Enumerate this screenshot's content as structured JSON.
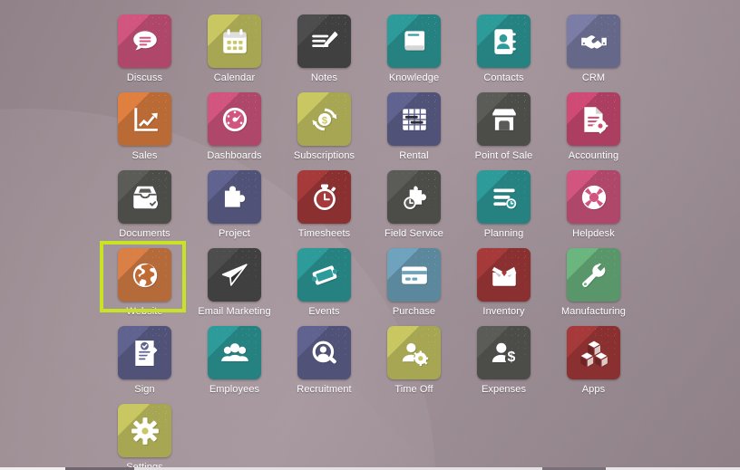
{
  "desktop": {
    "background_color": "#9b8c92",
    "highlight_color": "#c8e326"
  },
  "apps": [
    {
      "label": "Discuss",
      "icon": "chat-bubble-icon",
      "color": "#d1557f",
      "shadow_color": "#b0416a"
    },
    {
      "label": "Calendar",
      "icon": "calendar-icon",
      "color": "#c9c762",
      "shadow_color": "#a8a64c"
    },
    {
      "label": "Notes",
      "icon": "note-pencil-icon",
      "color": "#4d4d4d",
      "shadow_color": "#3a3a3a"
    },
    {
      "label": "Knowledge",
      "icon": "book-icon",
      "color": "#2e9b9b",
      "shadow_color": "#247c7c"
    },
    {
      "label": "Contacts",
      "icon": "address-book-icon",
      "color": "#2e9b9b",
      "shadow_color": "#247c7c"
    },
    {
      "label": "CRM",
      "icon": "handshake-icon",
      "color": "#7b7da6",
      "shadow_color": "#63658c"
    },
    {
      "label": "Sales",
      "icon": "chart-growth-icon",
      "color": "#e08040",
      "shadow_color": "#c06a30"
    },
    {
      "label": "Dashboards",
      "icon": "speedometer-icon",
      "color": "#d1557f",
      "shadow_color": "#b0416a"
    },
    {
      "label": "Subscriptions",
      "icon": "recurring-dollar-icon",
      "color": "#c9c762",
      "shadow_color": "#a8a64c"
    },
    {
      "label": "Rental",
      "icon": "gantt-grid-icon",
      "color": "#60638f",
      "shadow_color": "#4c4f75"
    },
    {
      "label": "Point of Sale",
      "icon": "storefront-icon",
      "color": "#5b5b58",
      "shadow_color": "#464643"
    },
    {
      "label": "Accounting",
      "icon": "invoice-gear-icon",
      "color": "#cf4b76",
      "shadow_color": "#ad3a60"
    },
    {
      "label": "Documents",
      "icon": "file-tray-check-icon",
      "color": "#5b5b58",
      "shadow_color": "#464643"
    },
    {
      "label": "Project",
      "icon": "puzzle-piece-icon",
      "color": "#60638f",
      "shadow_color": "#4c4f75"
    },
    {
      "label": "Timesheets",
      "icon": "stopwatch-icon",
      "color": "#a63a3a",
      "shadow_color": "#872c2c"
    },
    {
      "label": "Field Service",
      "icon": "worker-puzzle-icon",
      "color": "#5b5b58",
      "shadow_color": "#464643"
    },
    {
      "label": "Planning",
      "icon": "planning-lines-icon",
      "color": "#2e9b9b",
      "shadow_color": "#247c7c"
    },
    {
      "label": "Helpdesk",
      "icon": "life-ring-icon",
      "color": "#d1557f",
      "shadow_color": "#b0416a"
    },
    {
      "label": "Website",
      "icon": "globe-icon",
      "color": "#da7f45",
      "shadow_color": "#b96634",
      "highlighted": true
    },
    {
      "label": "Email Marketing",
      "icon": "paper-plane-icon",
      "color": "#4d4d4d",
      "shadow_color": "#3a3a3a"
    },
    {
      "label": "Events",
      "icon": "ticket-icon",
      "color": "#2e9b9b",
      "shadow_color": "#247c7c"
    },
    {
      "label": "Purchase",
      "icon": "credit-card-icon",
      "color": "#6fa3bd",
      "shadow_color": "#5888a1"
    },
    {
      "label": "Inventory",
      "icon": "open-box-icon",
      "color": "#a63a3a",
      "shadow_color": "#872c2c"
    },
    {
      "label": "Manufacturing",
      "icon": "wrench-icon",
      "color": "#6bb57f",
      "shadow_color": "#549a66"
    },
    {
      "label": "Sign",
      "icon": "signed-document-icon",
      "color": "#60638f",
      "shadow_color": "#4c4f75"
    },
    {
      "label": "Employees",
      "icon": "people-group-icon",
      "color": "#2e9b9b",
      "shadow_color": "#247c7c"
    },
    {
      "label": "Recruitment",
      "icon": "person-search-icon",
      "color": "#60638f",
      "shadow_color": "#4c4f75"
    },
    {
      "label": "Time Off",
      "icon": "person-gear-icon",
      "color": "#c9c762",
      "shadow_color": "#a8a64c"
    },
    {
      "label": "Expenses",
      "icon": "person-dollar-icon",
      "color": "#5b5b58",
      "shadow_color": "#464643"
    },
    {
      "label": "Apps",
      "icon": "cubes-icon",
      "color": "#a63a3a",
      "shadow_color": "#872c2c"
    },
    {
      "label": "Settings",
      "icon": "gear-icon",
      "color": "#c9c762",
      "shadow_color": "#a8a64c"
    }
  ]
}
